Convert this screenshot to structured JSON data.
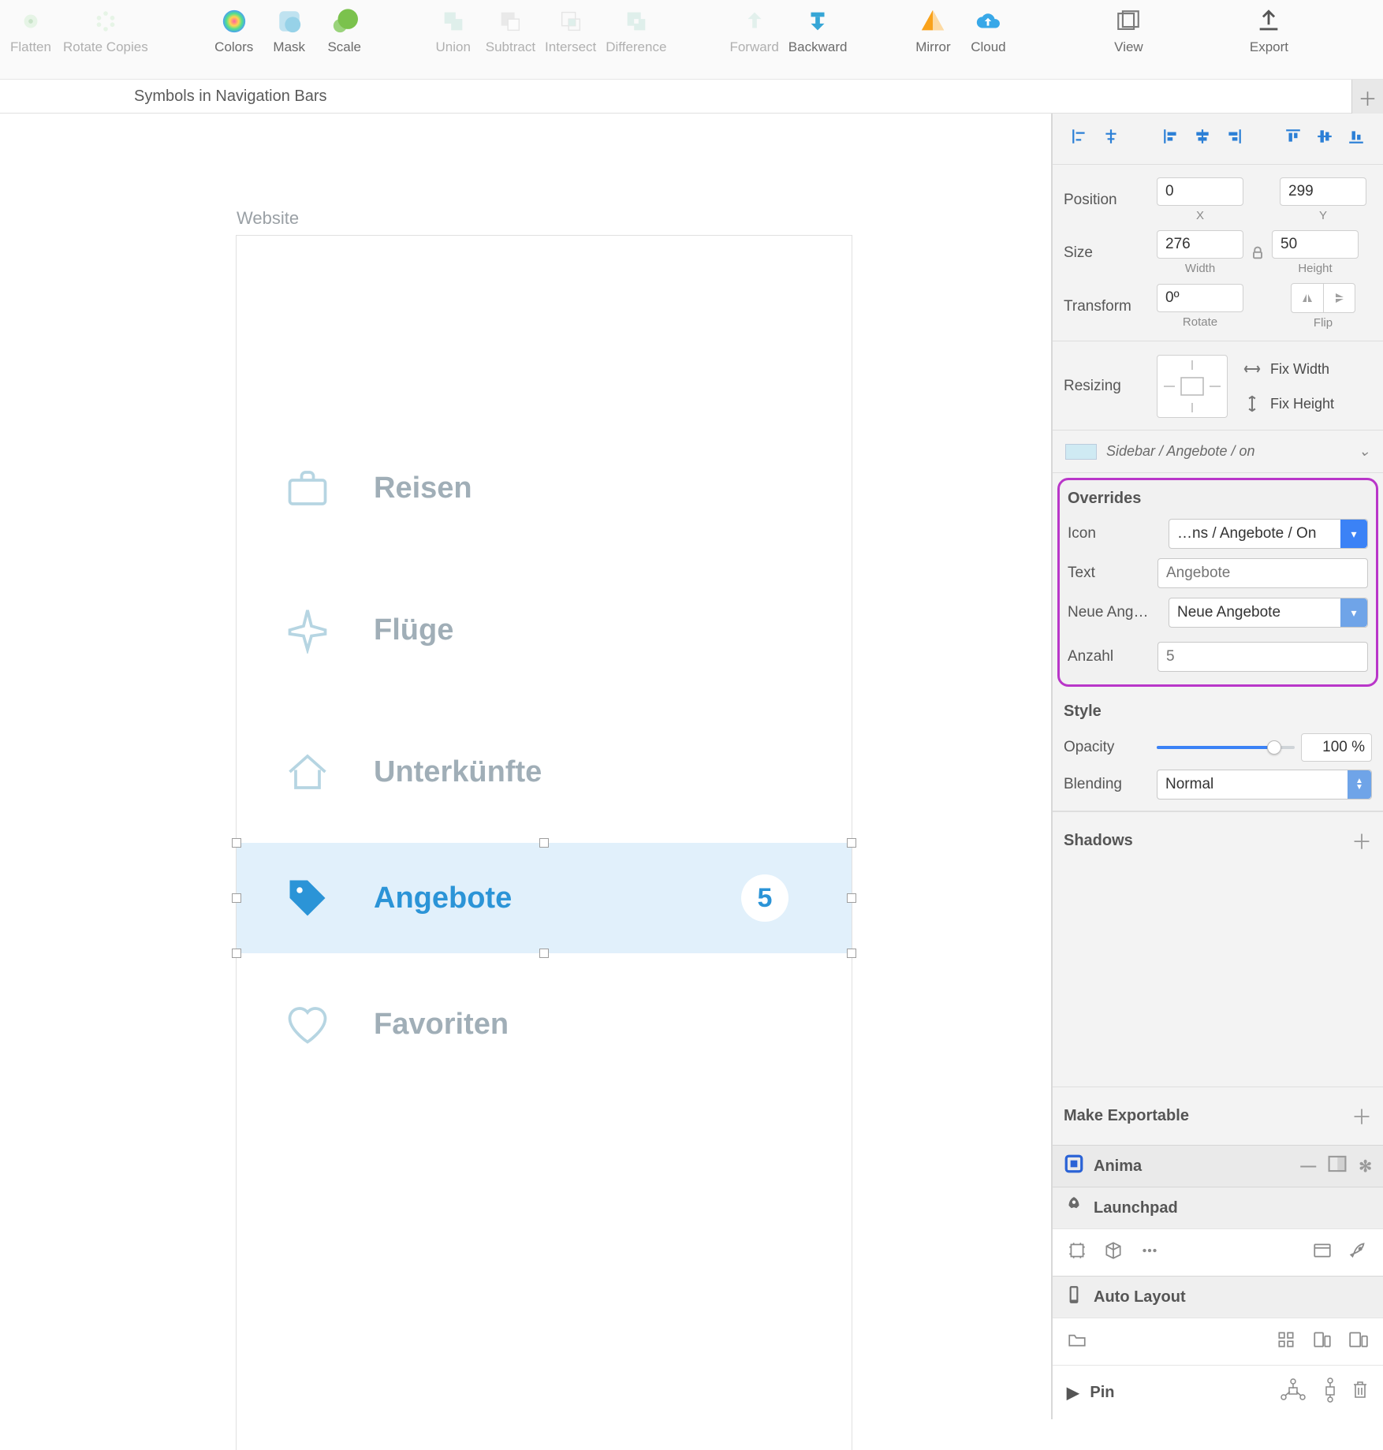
{
  "toolbar": {
    "flatten": "Flatten",
    "rotate_copies": "Rotate Copies",
    "colors": "Colors",
    "mask": "Mask",
    "scale": "Scale",
    "union": "Union",
    "subtract": "Subtract",
    "intersect": "Intersect",
    "difference": "Difference",
    "forward": "Forward",
    "backward": "Backward",
    "mirror": "Mirror",
    "cloud": "Cloud",
    "view": "View",
    "export": "Export"
  },
  "breadcrumb": "Symbols in Navigation Bars",
  "canvas": {
    "artboard_label": "Website",
    "nav": {
      "reisen": "Reisen",
      "fluege": "Flüge",
      "unterkuenfte": "Unterkünfte",
      "angebote": "Angebote",
      "favoriten": "Favoriten",
      "badge": "5"
    }
  },
  "inspector": {
    "position_label": "Position",
    "x": "0",
    "x_sub": "X",
    "y": "299",
    "y_sub": "Y",
    "size_label": "Size",
    "w": "276",
    "w_sub": "Width",
    "h": "50",
    "h_sub": "Height",
    "transform_label": "Transform",
    "rotate": "0º",
    "rotate_sub": "Rotate",
    "flip_sub": "Flip",
    "resizing_label": "Resizing",
    "fix_width": "Fix Width",
    "fix_height": "Fix Height",
    "symbol_name": "Sidebar / Angebote / on",
    "overrides": {
      "title": "Overrides",
      "icon_label": "Icon",
      "icon_value": "…ns / Angebote / On",
      "text_label": "Text",
      "text_value": "Angebote",
      "neue_label": "Neue Ang…",
      "neue_value": "Neue Angebote",
      "anzahl_label": "Anzahl",
      "anzahl_value": "5"
    },
    "style_title": "Style",
    "opacity_label": "Opacity",
    "opacity_value": "100 %",
    "blending_label": "Blending",
    "blending_value": "Normal",
    "shadows_label": "Shadows",
    "make_exportable": "Make Exportable",
    "anima": "Anima",
    "launchpad": "Launchpad",
    "auto_layout": "Auto Layout",
    "pin": "Pin"
  }
}
